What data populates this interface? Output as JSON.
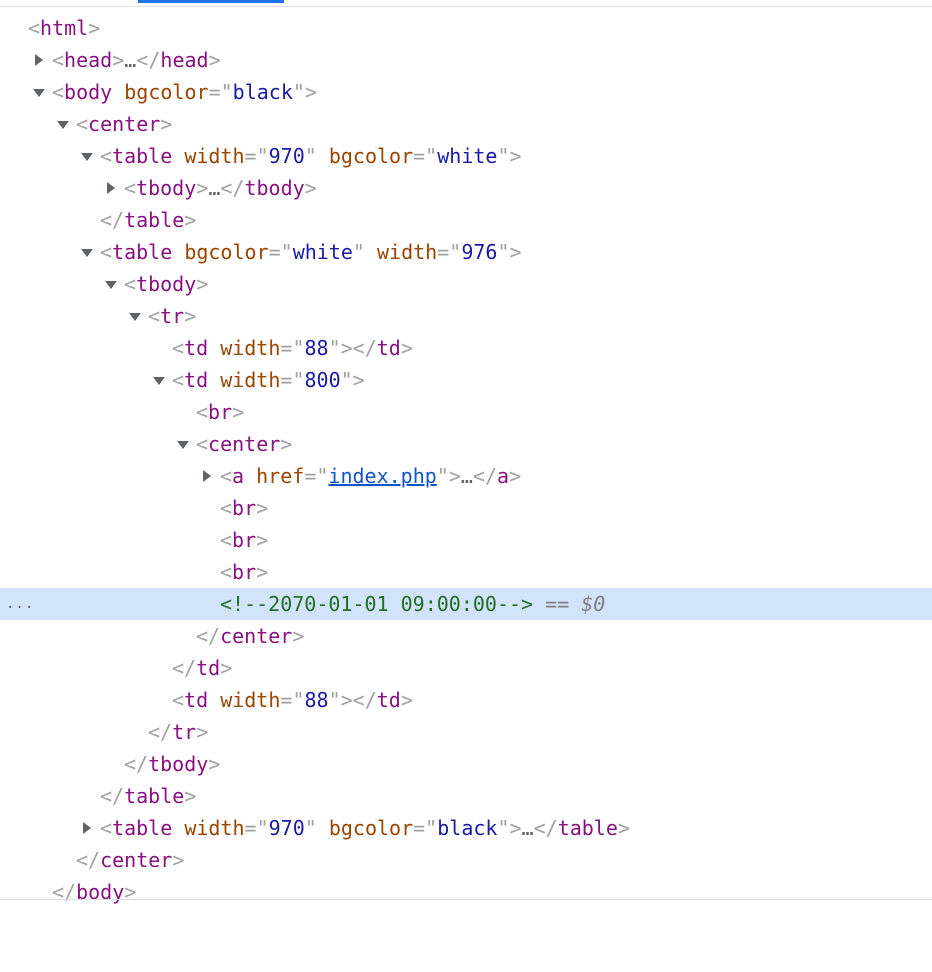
{
  "tree": {
    "html_open": "html",
    "head": "head",
    "body": "body",
    "bgcolor": "bgcolor",
    "black": "black",
    "center": "center",
    "table": "table",
    "tbody": "tbody",
    "width": "width",
    "w970": "970",
    "w976": "976",
    "white": "white",
    "tr": "tr",
    "td": "td",
    "w88": "88",
    "w800": "800",
    "br": "br",
    "a": "a",
    "href": "href",
    "index_link": "index.php",
    "comment": "<!--2070-01-01 09:00:00-->",
    "selected_suffix": "== $0",
    "ellipsis": "…",
    "gutter_dots": "..."
  }
}
